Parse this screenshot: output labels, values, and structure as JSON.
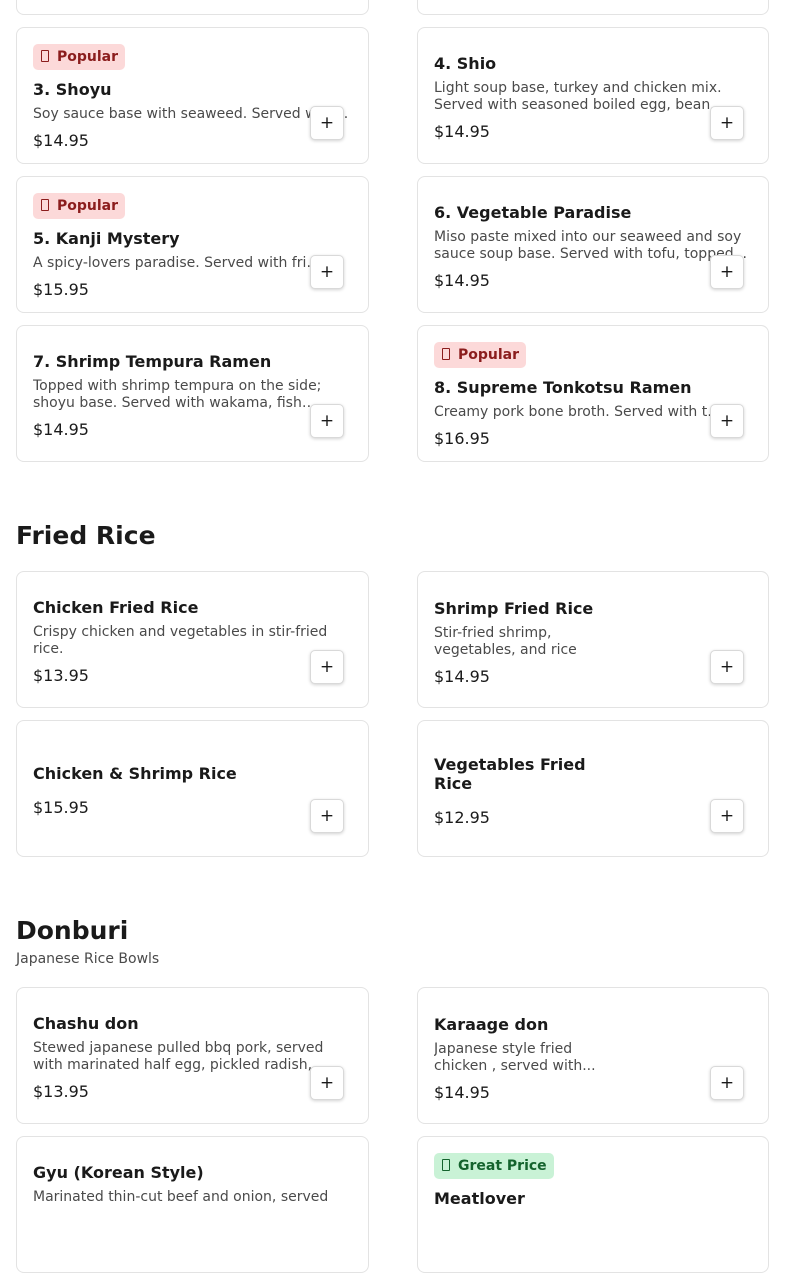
{
  "ramen": {
    "items": [
      {
        "badge": "Popular",
        "name": "3. Shoyu",
        "desc": "Soy sauce base with seaweed. Served with...",
        "price": "$14.95"
      },
      {
        "badge": "",
        "name": "4. Shio",
        "desc": "Light soup base, turkey and chicken mix. Served with seasoned boiled egg, bean...",
        "price": "$14.95"
      },
      {
        "badge": "Popular",
        "name": "5. Kanji Mystery",
        "desc": "A spicy-lovers paradise. Served with fried...",
        "price": "$15.95"
      },
      {
        "badge": "",
        "name": "6. Vegetable Paradise",
        "desc": "Miso paste mixed into our seaweed and soy sauce soup base. Served with tofu, topped...",
        "price": "$14.95"
      },
      {
        "badge": "",
        "name": "7. Shrimp Tempura Ramen",
        "desc": "Topped with shrimp tempura on the side; shoyu base. Served with wakama, fish cak...",
        "price": "$14.95"
      },
      {
        "badge": "Popular",
        "name": "8. Supreme Tonkotsu Ramen",
        "desc": "Creamy pork bone broth. Served with the...",
        "price": "$16.95"
      }
    ]
  },
  "fried_rice": {
    "title": "Fried Rice",
    "items": [
      {
        "name": "Chicken Fried Rice",
        "desc": "Crispy chicken and vegetables in stir-fried rice.",
        "price": "$13.95"
      },
      {
        "name": "Shrimp Fried Rice",
        "desc": "Stir-fried shrimp, vegetables, and rice",
        "price": "$14.95"
      },
      {
        "name": "Chicken & Shrimp Rice",
        "desc": "",
        "price": "$15.95"
      },
      {
        "name": "Vegetables Fried Rice",
        "desc": "",
        "price": "$12.95"
      }
    ]
  },
  "donburi": {
    "title": "Donburi",
    "subtitle": "Japanese Rice Bowls",
    "items": [
      {
        "badge": "",
        "name": "Chashu don",
        "desc": "Stewed japanese pulled bbq pork, served with marinated half egg, pickled radish,...",
        "price": "$13.95"
      },
      {
        "badge": "",
        "name": "Karaage don",
        "desc": "Japanese style fried chicken , served with...",
        "price": "$14.95"
      },
      {
        "badge": "",
        "name": "Gyu (Korean Style)",
        "desc": "Marinated thin-cut beef and onion, served",
        "price": ""
      },
      {
        "badge": "Great Price",
        "name": "Meatlover",
        "desc": "",
        "price": ""
      }
    ]
  },
  "add_label": "+",
  "colors": {
    "popular_bg": "#fcd9d9",
    "popular_text": "#8b1d1d",
    "great_bg": "#c9f2d6",
    "great_text": "#14632d"
  }
}
